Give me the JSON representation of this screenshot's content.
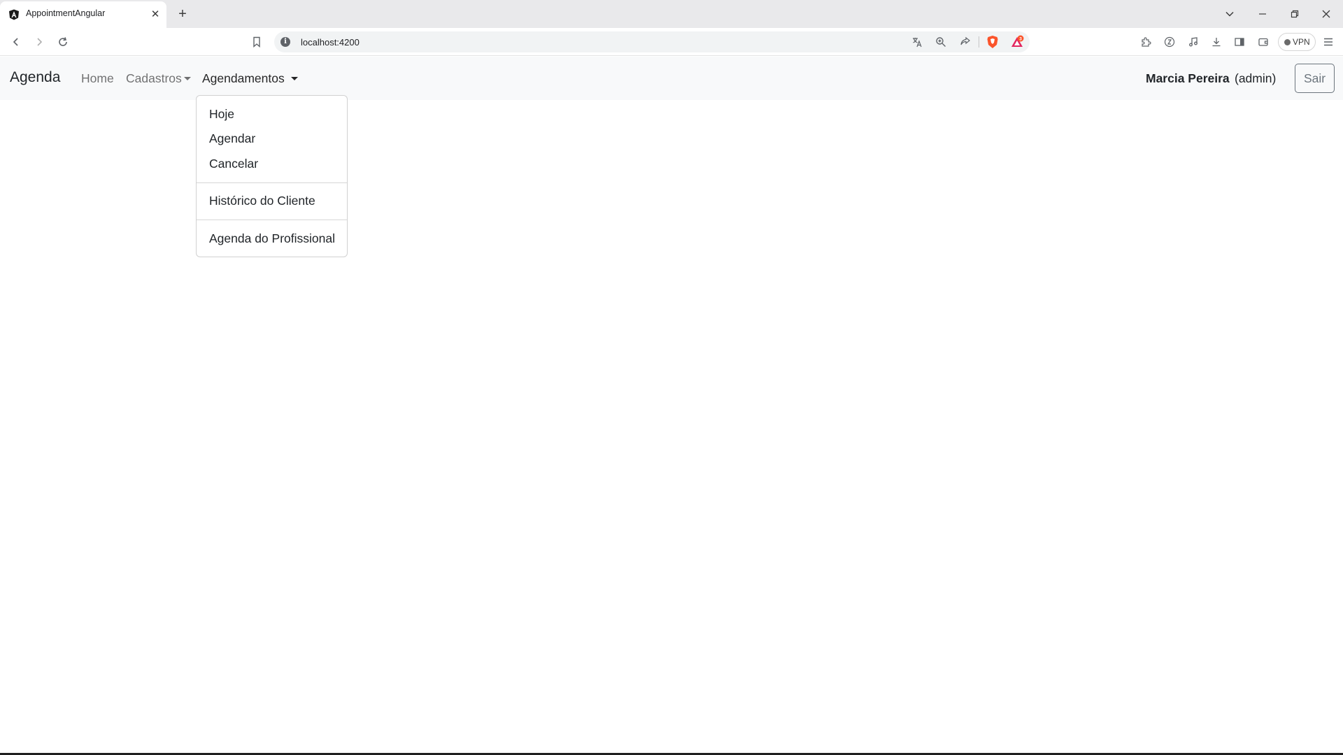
{
  "browser": {
    "tab_title": "AppointmentAngular",
    "url": "localhost:4200",
    "vpn_label": "VPN",
    "rewards_badge": "3"
  },
  "navbar": {
    "brand": "Agenda",
    "links": {
      "home": "Home",
      "cadastros": "Cadastros",
      "agendamentos": "Agendamentos"
    },
    "user": {
      "name": "Marcia Pereira",
      "role": "(admin)"
    },
    "logout_label": "Sair"
  },
  "dropdown": {
    "items": [
      "Hoje",
      "Agendar",
      "Cancelar",
      "Histórico do Cliente",
      "Agenda do Profissional"
    ]
  },
  "colors": {
    "navbar_bg": "#f8f9fa",
    "brave_orange": "#fb542b"
  }
}
